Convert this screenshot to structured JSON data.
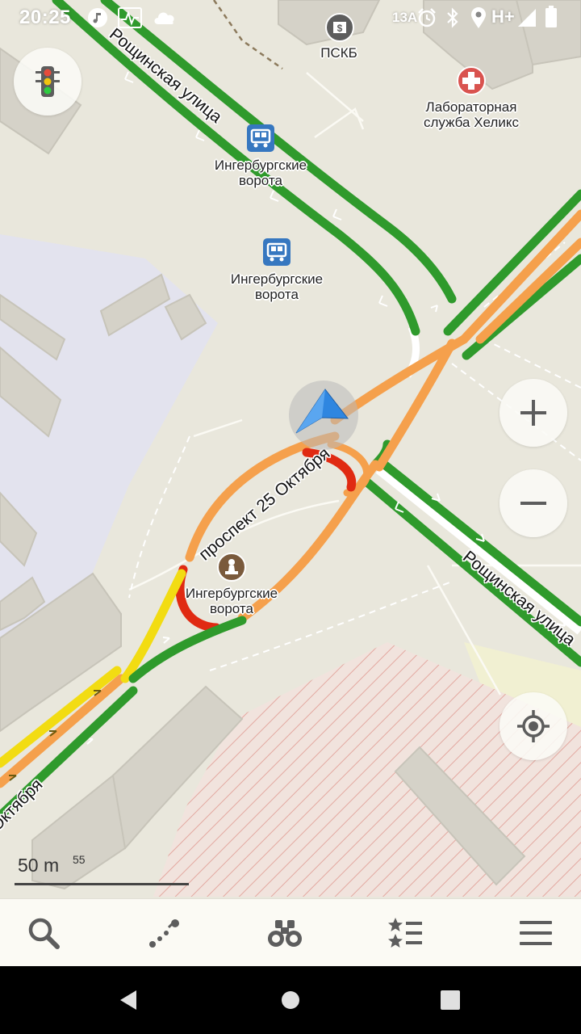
{
  "status_bar": {
    "time": "20:25",
    "signal_label": "13A",
    "network_label": "H+",
    "icons": [
      "music-icon",
      "activity-icon",
      "cloud-icon",
      "alarm-icon",
      "bluetooth-icon",
      "location-icon",
      "cell-signal-icon",
      "battery-icon"
    ]
  },
  "map": {
    "pois": [
      {
        "id": "bank",
        "icon": "bank-icon",
        "name": [
          "ПСКБ"
        ]
      },
      {
        "id": "lab",
        "icon": "medical-cross-icon",
        "name": [
          "Лабораторная",
          "служба Хеликс"
        ]
      },
      {
        "id": "bus-stop-1",
        "icon": "bus-stop-icon",
        "name": [
          "Ингербургские",
          "ворота"
        ]
      },
      {
        "id": "bus-stop-2",
        "icon": "bus-stop-icon",
        "name": [
          "Ингербургские",
          "ворота"
        ]
      },
      {
        "id": "monument",
        "icon": "monument-icon",
        "name": [
          "Ингербургские",
          "ворота"
        ]
      }
    ],
    "streets": {
      "roshchinskaya_top": "Рощинская улица",
      "roshchinskaya_right": "Рощинская улица",
      "prospekt": "проспект 25 Октября",
      "oktyabrya_bottom": "Октября"
    },
    "colors": {
      "traffic_free": "#2f9a2c",
      "traffic_moderate": "#f5a04c",
      "traffic_slow": "#f2dc12",
      "traffic_jam": "#e02a12",
      "position_arrow": "#2f86e0"
    }
  },
  "controls": {
    "traffic_toggle": "traffic-light-icon",
    "zoom_in": "plus-icon",
    "zoom_out": "minus-icon",
    "my_location": "crosshair-icon"
  },
  "scale": {
    "label": "50 m",
    "zoom_level": "55"
  },
  "toolbar": {
    "items": [
      {
        "name": "search",
        "icon": "search-icon"
      },
      {
        "name": "route",
        "icon": "route-icon"
      },
      {
        "name": "discover",
        "icon": "binoculars-icon"
      },
      {
        "name": "bookmarks",
        "icon": "bookmarks-list-icon"
      },
      {
        "name": "menu",
        "icon": "hamburger-menu-icon"
      }
    ]
  },
  "nav_bar": {
    "items": [
      "back-icon",
      "home-icon",
      "recents-icon"
    ]
  }
}
